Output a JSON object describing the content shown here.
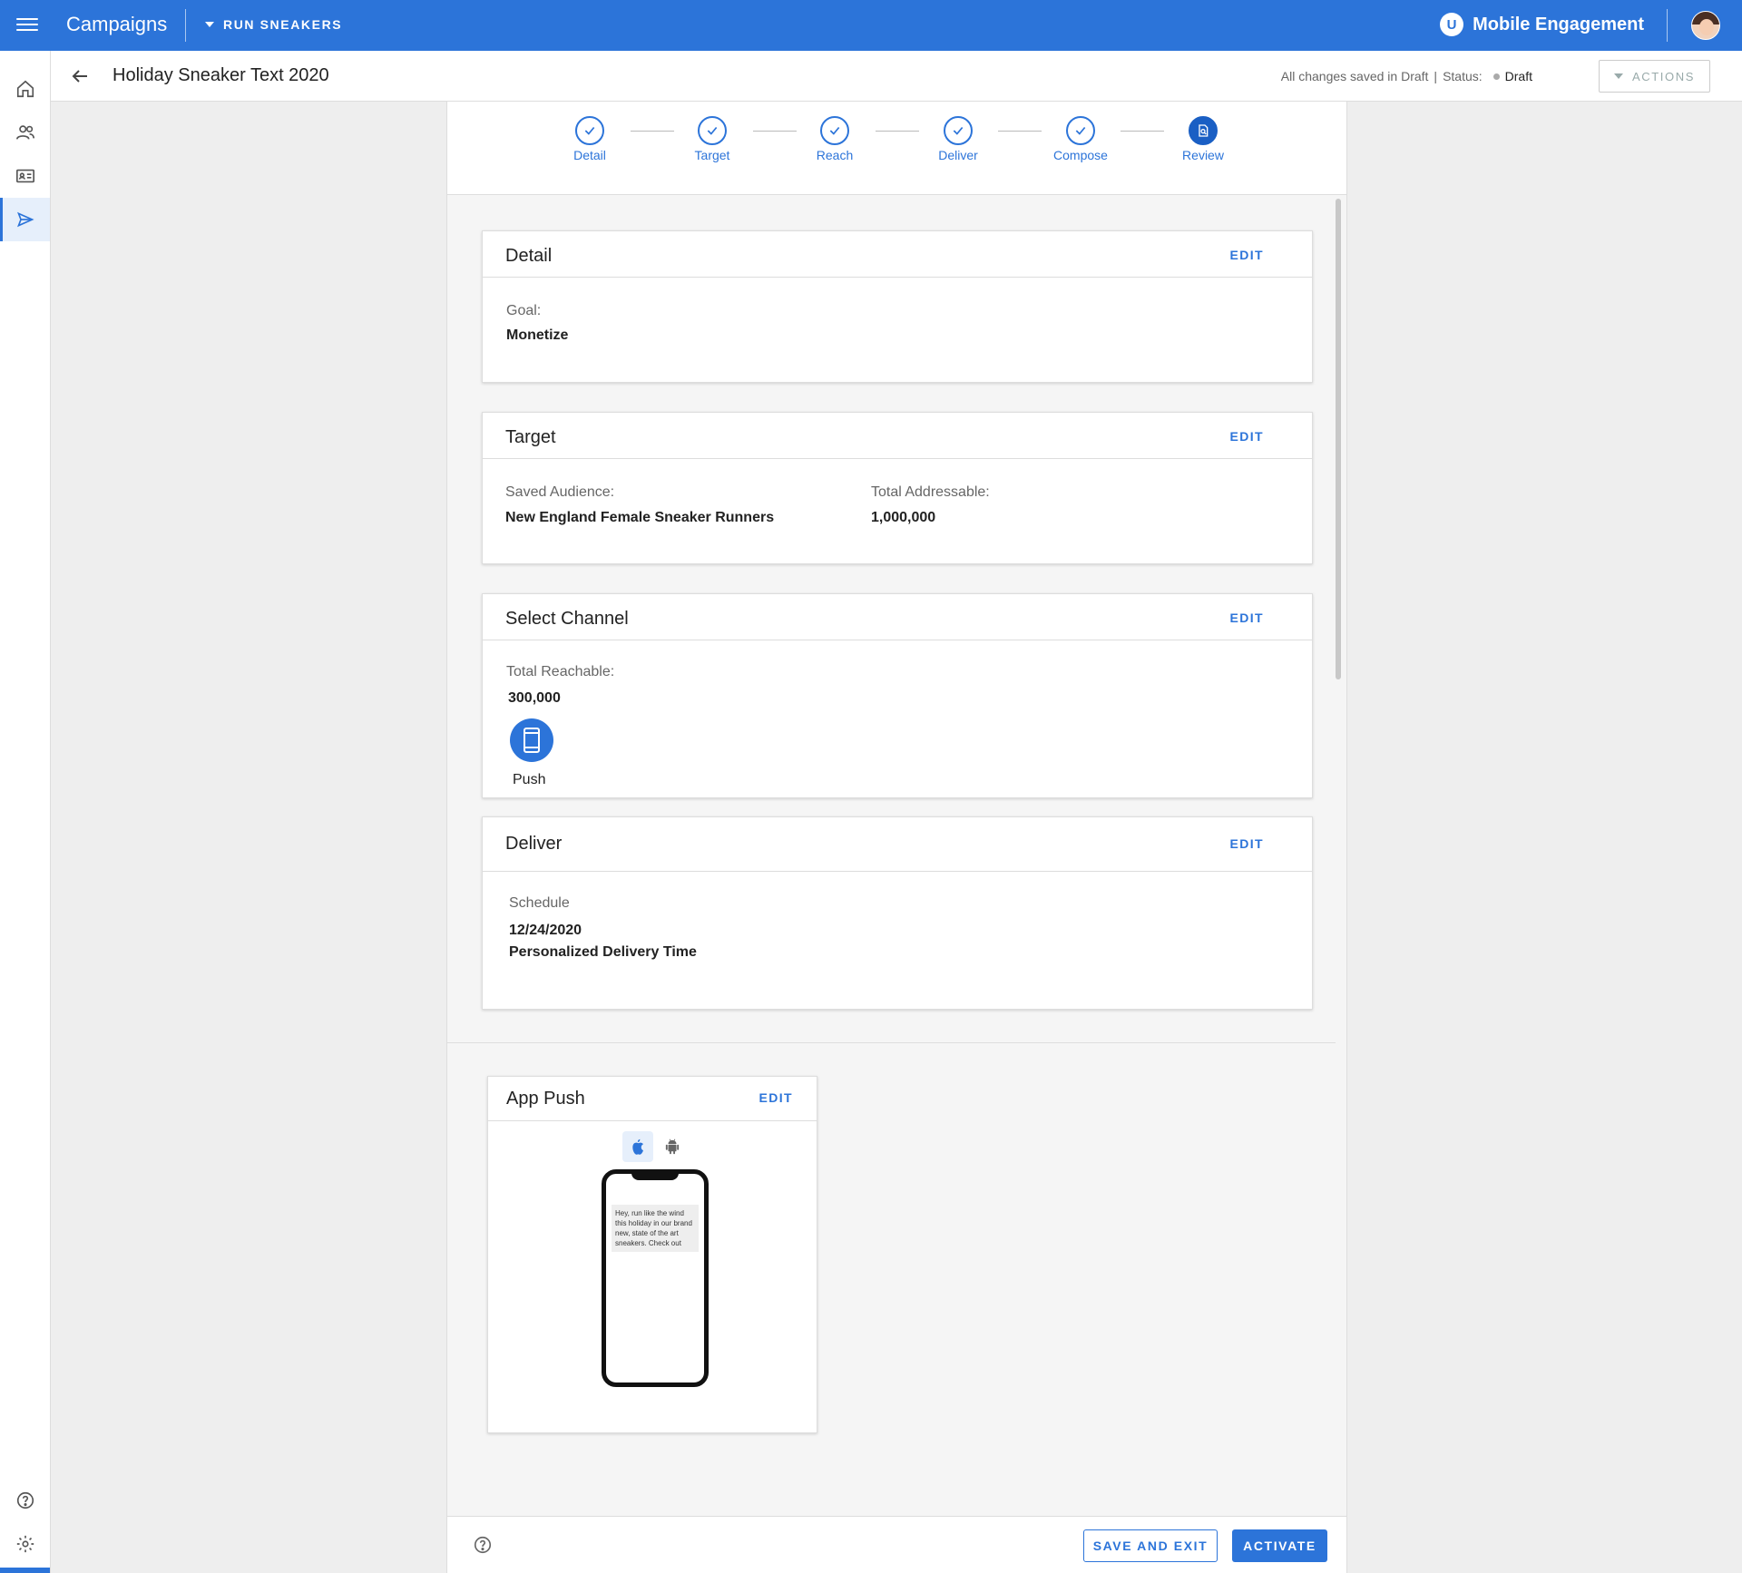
{
  "topbar": {
    "app_title": "Campaigns",
    "brand_selector": "RUN SNEAKERS",
    "logo_letter": "U",
    "product_name": "Mobile Engagement"
  },
  "subheader": {
    "title": "Holiday Sneaker Text 2020",
    "save_status": "All changes saved in Draft",
    "separator": "|",
    "status_label": "Status:",
    "status_value": "Draft",
    "actions_label": "ACTIONS"
  },
  "stepper": {
    "steps": [
      {
        "label": "Detail",
        "state": "complete"
      },
      {
        "label": "Target",
        "state": "complete"
      },
      {
        "label": "Reach",
        "state": "complete"
      },
      {
        "label": "Deliver",
        "state": "complete"
      },
      {
        "label": "Compose",
        "state": "complete"
      },
      {
        "label": "Review",
        "state": "current"
      }
    ]
  },
  "cards": {
    "edit_label": "EDIT",
    "detail": {
      "title": "Detail",
      "goal_label": "Goal:",
      "goal_value": "Monetize"
    },
    "target": {
      "title": "Target",
      "audience_label": "Saved Audience:",
      "audience_value": "New England Female Sneaker Runners",
      "addressable_label": "Total Addressable:",
      "addressable_value": "1,000,000"
    },
    "channel": {
      "title": "Select Channel",
      "reachable_label": "Total Reachable:",
      "reachable_value": "300,000",
      "channel_name": "Push"
    },
    "deliver": {
      "title": "Deliver",
      "schedule_label": "Schedule",
      "date_value": "12/24/2020",
      "timing_value": "Personalized Delivery Time"
    },
    "app_push": {
      "title": "App Push",
      "message_preview": "Hey, run like the wind this holiday in our brand new, state of the art sneakers. Check out"
    }
  },
  "footer": {
    "save_exit_label": "SAVE AND EXIT",
    "activate_label": "ACTIVATE"
  },
  "colors": {
    "primary": "#2c74d9",
    "current_step": "#1a5fc4"
  }
}
